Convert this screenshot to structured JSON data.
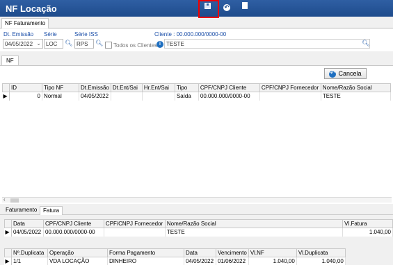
{
  "window": {
    "title": "NF Locação"
  },
  "tabs": {
    "nf_faturamento": "NF Faturamento",
    "nf": "NF"
  },
  "filters": {
    "dt_emissao_label": "Dt. Emissão",
    "dt_emissao_value": "04/05/2022",
    "serie_label": "Série",
    "serie_value": "LOC",
    "serie_iss_label": "Série ISS",
    "serie_iss_value": "RPS",
    "todos_clientes_label": "Todos os Clientes",
    "cliente_label": "Cliente : 00.000.000/0000-00",
    "cliente_value": "TESTE"
  },
  "toolbar": {
    "cancel_label": "Cancela"
  },
  "main_grid": {
    "columns": [
      "ID",
      "Tipo NF",
      "Dt.Emissão",
      "Dt.Ent/Sai",
      "Hr.Ent/Sai",
      "Tipo",
      "CPF/CNPJ Cliente",
      "CPF/CNPJ Fornecedor",
      "Nome/Razão Social"
    ],
    "rows": [
      {
        "id": "0",
        "tipo_nf": "Normal",
        "dt_emissao": "04/05/2022",
        "dt_ent_sai": "",
        "hr_ent_sai": "",
        "tipo": "Saída",
        "cpf_cliente": "00.000.000/0000-00",
        "cpf_fornecedor": "",
        "nome": "TESTE"
      }
    ]
  },
  "sub_tabs": {
    "faturamento": "Faturamento",
    "fatura": "Fatura"
  },
  "fatura_grid": {
    "columns": [
      "Data",
      "CPF/CNPJ Cliente",
      "CPF/CNPJ  Fornecedor",
      "Nome/Razão Social",
      "Vl.Fatura"
    ],
    "rows": [
      {
        "data": "04/05/2022",
        "cpf_cliente": "00.000.000/0000-00",
        "cpf_fornecedor": "",
        "nome": "TESTE",
        "vl_fatura": "1.040,00"
      }
    ]
  },
  "duplicata_grid": {
    "columns": [
      "Nº.Duplicata",
      "Operação",
      "Forma Pagamento",
      "Data",
      "Vencimento",
      "Vl.NF",
      "Vl.Duplicata"
    ],
    "rows": [
      {
        "numero": "1/1",
        "operacao": "VDA LOCAÇÃO",
        "forma_pagamento": "DINHEIRO",
        "data": "04/05/2022",
        "vencimento": "01/06/2022",
        "vl_nf": "1.040,00",
        "vl_duplicata": "1.040,00"
      }
    ]
  }
}
